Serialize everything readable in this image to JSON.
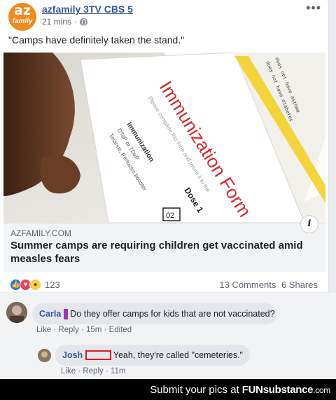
{
  "post": {
    "avatar_line1": "az",
    "avatar_line2": "family",
    "page_name": "azfamily 3TV CBS 5",
    "time": "21 mins",
    "privacy_icon": "globe-icon",
    "more_icon": "more-options-icon",
    "text": "\"Camps have definitely taken the stand.\""
  },
  "photo": {
    "form_title": "Immunization Form",
    "form_subtitle": "Please complete this form and return it to the",
    "row1": "Immunization",
    "row2": "DTaP or TDaP",
    "row3": "Tetanus, Pertussis booster",
    "dose": "Dose 1",
    "date_stub": "02",
    "corner_line1": "does not have asthma",
    "corner_line2": "does not have diabetes"
  },
  "link": {
    "domain": "AZFAMILY.COM",
    "headline": "Summer camps are requiring children get vaccinated amid measles fears",
    "info_label": "i"
  },
  "reactions": {
    "count": "123",
    "comments": "13 Comments",
    "shares": "6 Shares",
    "icons": [
      "like-reaction-icon",
      "love-reaction-icon",
      "wow-reaction-icon"
    ]
  },
  "comments": [
    {
      "name": "Carla",
      "text": "Do they offer camps for kids that are not vaccinated?",
      "like": "Like",
      "reply": "Reply",
      "time": "15m",
      "edited": "Edited"
    },
    {
      "name": "Josh",
      "text": "Yeah, they're called \"cemeteries.\"",
      "like": "Like",
      "reply": "Reply",
      "time": "11m"
    }
  ],
  "footer": {
    "text": "Submit your pics at",
    "brand_fun": "FUN",
    "brand_sub": "substance",
    "brand_com": ".com"
  },
  "colors": {
    "link_blue": "#385898",
    "purple_redaction": "#a62fb1",
    "red_redaction": "#e3161e",
    "brand_orange": "#f28a1e"
  }
}
